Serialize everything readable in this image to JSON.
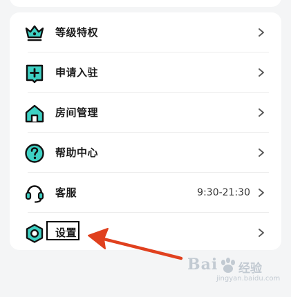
{
  "menu": {
    "items": [
      {
        "label": "等级特权",
        "value": "",
        "icon": "crown-icon"
      },
      {
        "label": "申请入驻",
        "value": "",
        "icon": "plus-badge-icon"
      },
      {
        "label": "房间管理",
        "value": "",
        "icon": "home-icon"
      },
      {
        "label": "帮助中心",
        "value": "",
        "icon": "question-circle-icon"
      },
      {
        "label": "客服",
        "value": "9:30-21:30",
        "icon": "headset-icon"
      },
      {
        "label": "设置",
        "value": "",
        "icon": "settings-hexagon-icon"
      }
    ]
  },
  "annotation": {
    "arrow_color": "#e0401e",
    "box_color": "#000000"
  },
  "watermark": {
    "brand": "Bai",
    "brand_cn": "经验",
    "url": "jingyan.baidu.com"
  },
  "colors": {
    "icon_fill": "#3ed1c4",
    "icon_stroke": "#111111"
  }
}
